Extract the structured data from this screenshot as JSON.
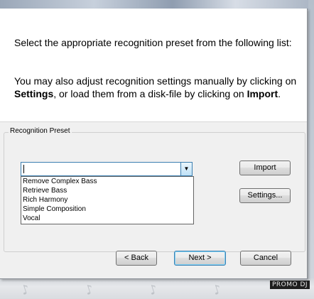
{
  "intro": {
    "line1": "Select the appropriate recognition preset from the following list:",
    "line2_before_settings": "You may also adjust recognition settings manually by clicking on ",
    "settings_word": "Settings",
    "line2_middle": ", or load them from a disk-file by clicking on ",
    "import_word": "Import",
    "line2_end": "."
  },
  "preset_group": {
    "title": "Recognition Preset",
    "combo_value": "",
    "options": [
      "Remove Complex Bass",
      "Retrieve Bass",
      "Rich Harmony",
      "Simple Composition",
      "Vocal"
    ]
  },
  "buttons": {
    "import": "Import",
    "settings": "Settings...",
    "back": "< Back",
    "next": "Next >",
    "cancel": "Cancel"
  },
  "watermark": {
    "badge": "PROMO DJ"
  }
}
